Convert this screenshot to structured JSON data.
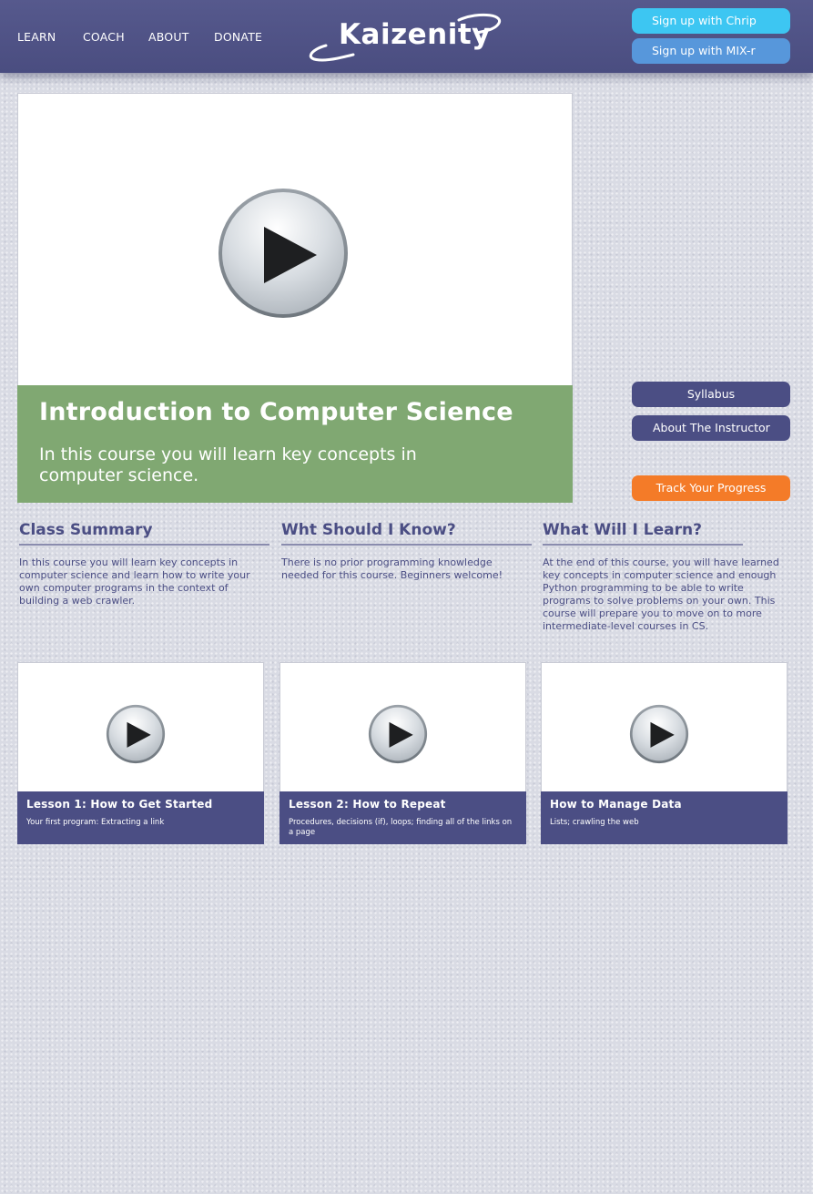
{
  "nav": {
    "items": [
      {
        "label": "LEARN"
      },
      {
        "label": "COACH"
      },
      {
        "label": "ABOUT"
      },
      {
        "label": "DONATE"
      }
    ]
  },
  "brand": {
    "name": "Kaizenity"
  },
  "auth": {
    "chrip_label": "Sign up with Chrip",
    "mix_label": "Sign up with MIX-r"
  },
  "course": {
    "title": "Introduction to Computer Science",
    "description": "In this course you will learn key concepts in computer science."
  },
  "sidebar": {
    "syllabus_label": "Syllabus",
    "instructor_label": "About The Instructor",
    "track_label": "Track Your Progress"
  },
  "sections": [
    {
      "heading": "Class Summary",
      "text": "In this course you will learn key concepts in computer science and learn how to write your own computer programs in the context of building a web crawler."
    },
    {
      "heading": "Wht Should I Know?",
      "text": "There is no prior programming knowledge needed for this course. Beginners welcome!"
    },
    {
      "heading": "What Will I Learn?",
      "text": "At the end of this course, you will have learned key concepts in computer science and enough Python programming to be able to write programs to solve problems on your own. This course will prepare you to move on to more intermediate-level courses in CS."
    }
  ],
  "lessons": [
    {
      "title": "Lesson 1: How to Get Started",
      "subtitle": "Your first program: Extracting a link"
    },
    {
      "title": "Lesson 2: How to Repeat",
      "subtitle": "Procedures, decisions (if), loops; finding all of the links on a page"
    },
    {
      "title": "How to Manage Data",
      "subtitle": "Lists; crawling the web"
    }
  ],
  "colors": {
    "header": "#4e5185",
    "accent_blue": "#3dc6f2",
    "accent_mid_blue": "#5797db",
    "hero_green": "#80a872",
    "track_orange": "#f47b28",
    "text_navy": "#4b4e84"
  },
  "icons": {
    "play": "play-icon",
    "logo_swoosh": "swoosh-icon"
  }
}
